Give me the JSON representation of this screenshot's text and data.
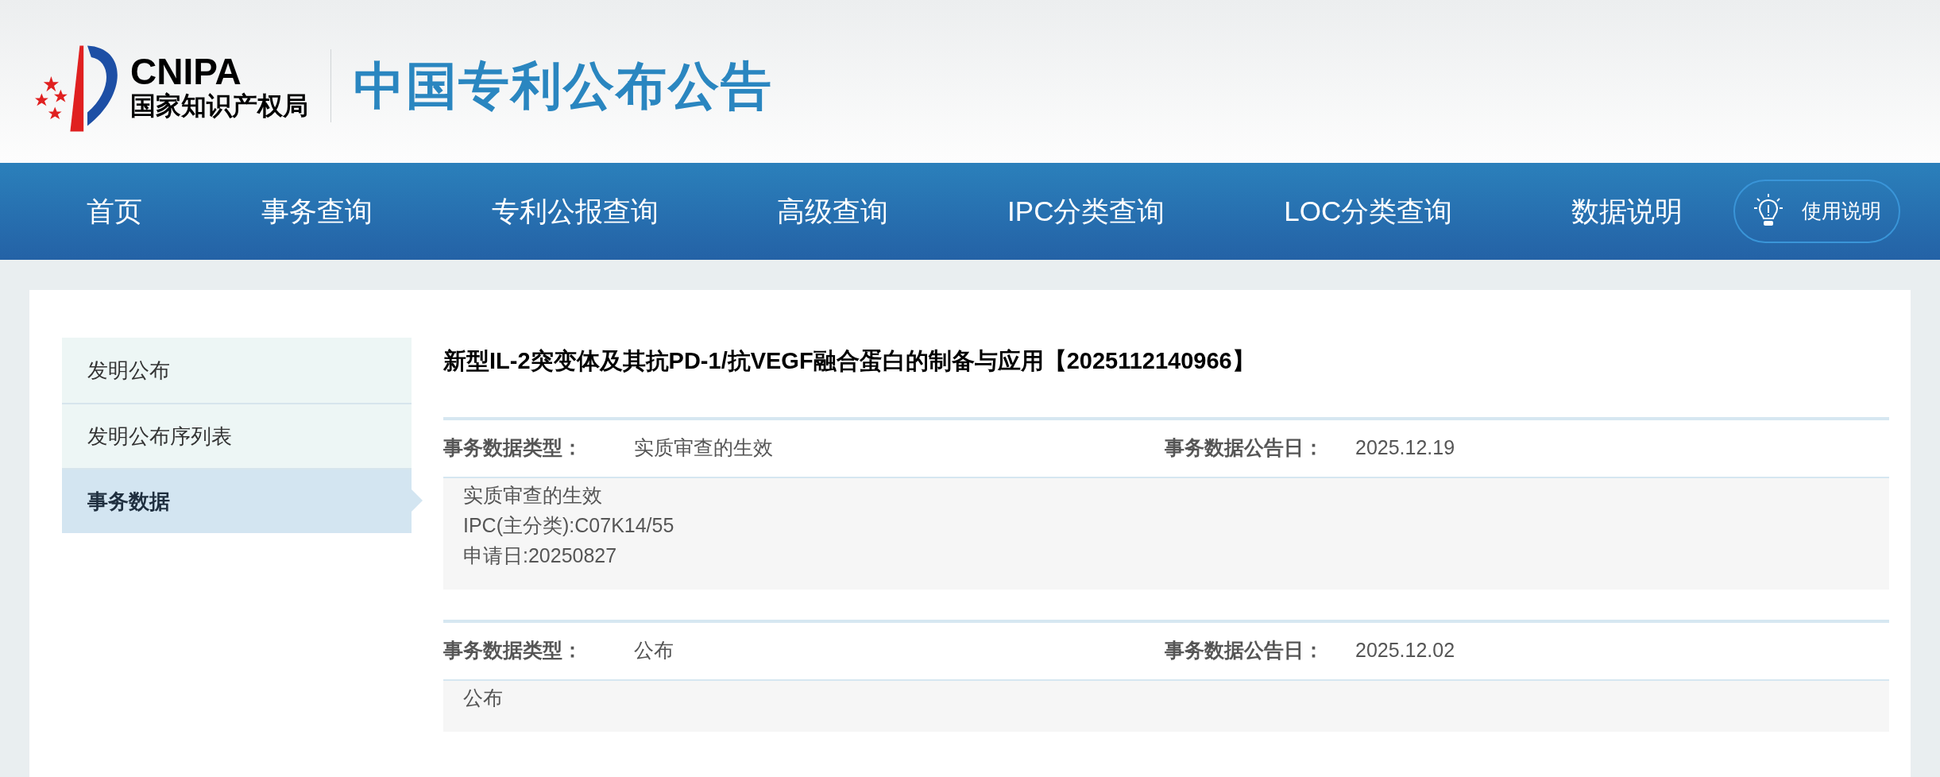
{
  "header": {
    "logo_abbr": "CNIPA",
    "logo_name": "国家知识产权局",
    "site_title": "中国专利公布公告"
  },
  "nav": {
    "items": [
      {
        "label": "首页",
        "selected": false
      },
      {
        "label": "事务查询",
        "selected": false
      },
      {
        "label": "专利公报查询",
        "selected": false
      },
      {
        "label": "高级查询",
        "selected": false
      },
      {
        "label": "IPC分类查询",
        "selected": false
      },
      {
        "label": "LOC分类查询",
        "selected": false
      },
      {
        "label": "数据说明",
        "selected": false
      }
    ],
    "help_button": "使用说明"
  },
  "sidebar": {
    "items": [
      {
        "label": "发明公布",
        "selected": false
      },
      {
        "label": "发明公布序列表",
        "selected": false
      },
      {
        "label": "事务数据",
        "selected": true
      }
    ]
  },
  "content": {
    "title": "新型IL-2突变体及其抗PD-1/抗VEGF融合蛋白的制备与应用【2025112140966】",
    "records": [
      {
        "type_label": "事务数据类型：",
        "type": "实质审查的生效",
        "date_label": "事务数据公告日：",
        "date": "2025.12.19",
        "details": [
          "实质审查的生效",
          "IPC(主分类):C07K14/55",
          "申请日:20250827"
        ]
      },
      {
        "type_label": "事务数据类型：",
        "type": "公布",
        "date_label": "事务数据公告日：",
        "date": "2025.12.02",
        "details": [
          "公布"
        ]
      }
    ]
  }
}
